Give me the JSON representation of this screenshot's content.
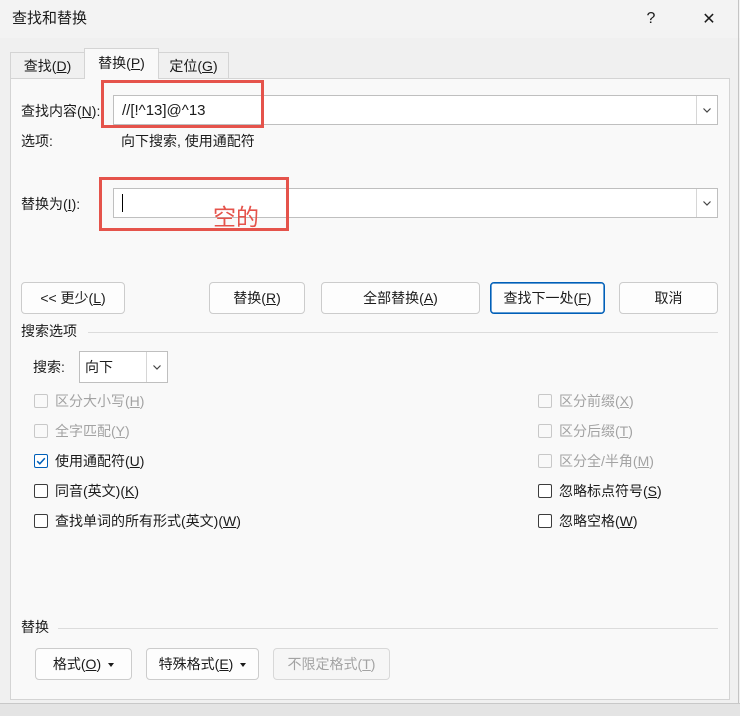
{
  "window": {
    "title": "查找和替换",
    "help": "?",
    "close": "✕"
  },
  "tabs": [
    {
      "label": "查找(D)",
      "selected": false
    },
    {
      "label": "替换(P)",
      "selected": true
    },
    {
      "label": "定位(G)",
      "selected": false
    }
  ],
  "find": {
    "label": "查找内容(N):",
    "value": "//[!^13]@^13"
  },
  "options": {
    "label": "选项:",
    "value": "向下搜索, 使用通配符"
  },
  "replace": {
    "label": "替换为(I):",
    "value": ""
  },
  "annotation": {
    "note": "空的"
  },
  "buttons": {
    "less": "<< 更少(L)",
    "replace": "替换(R)",
    "replace_all": "全部替换(A)",
    "find_next": "查找下一处(F)",
    "cancel": "取消"
  },
  "search_options": {
    "header": "搜索选项",
    "direction_label": "搜索:",
    "direction_value": "向下",
    "left": [
      {
        "label": "区分大小写(H)",
        "checked": false,
        "enabled": false
      },
      {
        "label": "全字匹配(Y)",
        "checked": false,
        "enabled": false
      },
      {
        "label": "使用通配符(U)",
        "checked": true,
        "enabled": true
      },
      {
        "label": "同音(英文)(K)",
        "checked": false,
        "enabled": true
      },
      {
        "label": "查找单词的所有形式(英文)(W)",
        "checked": false,
        "enabled": true
      }
    ],
    "right": [
      {
        "label": "区分前缀(X)",
        "checked": false,
        "enabled": false
      },
      {
        "label": "区分后缀(T)",
        "checked": false,
        "enabled": false
      },
      {
        "label": "区分全/半角(M)",
        "checked": false,
        "enabled": false
      },
      {
        "label": "忽略标点符号(S)",
        "checked": false,
        "enabled": true
      },
      {
        "label": "忽略空格(W)",
        "checked": false,
        "enabled": true
      }
    ]
  },
  "replace_section": {
    "header": "替换",
    "format": "格式(O)",
    "special": "特殊格式(E)",
    "no_format": "不限定格式(T)",
    "no_format_enabled": false
  },
  "colors": {
    "accent": "#005fb8",
    "annotation": "#e5534b",
    "disabled_text": "#a3a3a3"
  },
  "icons": {
    "help": "help-icon",
    "close": "close-icon",
    "combo_arrow": "chevron-down-icon",
    "menu_arrow": "caret-down-icon",
    "check": "checkmark-icon"
  }
}
